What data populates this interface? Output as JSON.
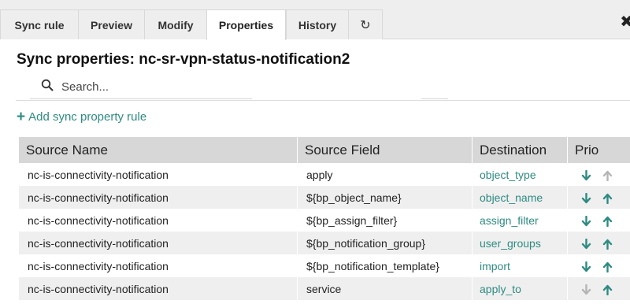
{
  "tabs": [
    {
      "label": "Sync rule"
    },
    {
      "label": "Preview"
    },
    {
      "label": "Modify"
    },
    {
      "label": "Properties",
      "active": true
    },
    {
      "label": "History"
    }
  ],
  "refresh_icon": "↻",
  "close_icon": "✖",
  "title": "Sync properties: nc-sr-vpn-status-notification2",
  "search": {
    "placeholder": "Search...",
    "value": ""
  },
  "add_rule": {
    "label": "Add sync property rule",
    "icon": "plus-icon"
  },
  "colors": {
    "accent": "#2e8b82",
    "arrow_active": "#2e8b82",
    "arrow_disabled": "#b5b5b5",
    "header_bg": "#d7d7d7"
  },
  "table": {
    "headers": [
      "Source Name",
      "Source Field",
      "Destination",
      "Prio"
    ],
    "rows": [
      {
        "source_name": "nc-is-connectivity-notification",
        "source_field": "apply",
        "destination": "object_type",
        "down_enabled": true,
        "up_enabled": false
      },
      {
        "source_name": "nc-is-connectivity-notification",
        "source_field": "${bp_object_name}",
        "destination": "object_name",
        "down_enabled": true,
        "up_enabled": true
      },
      {
        "source_name": "nc-is-connectivity-notification",
        "source_field": "${bp_assign_filter}",
        "destination": "assign_filter",
        "down_enabled": true,
        "up_enabled": true
      },
      {
        "source_name": "nc-is-connectivity-notification",
        "source_field": "${bp_notification_group}",
        "destination": "user_groups",
        "down_enabled": true,
        "up_enabled": true
      },
      {
        "source_name": "nc-is-connectivity-notification",
        "source_field": "${bp_notification_template}",
        "destination": "import",
        "down_enabled": true,
        "up_enabled": true
      },
      {
        "source_name": "nc-is-connectivity-notification",
        "source_field": "service",
        "destination": "apply_to",
        "down_enabled": false,
        "up_enabled": true
      }
    ]
  }
}
